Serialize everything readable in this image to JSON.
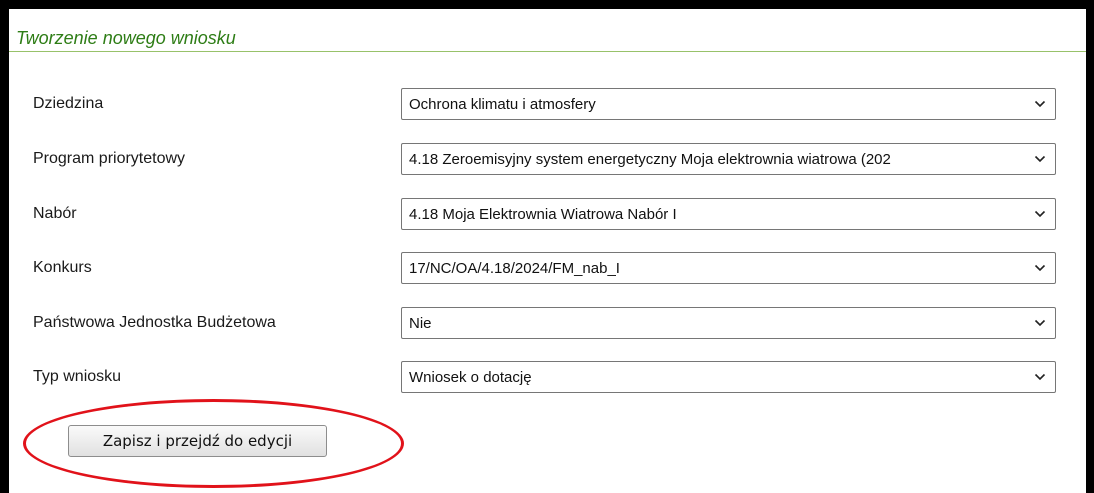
{
  "form": {
    "title": "Tworzenie nowego wniosku",
    "fields": [
      {
        "label": "Dziedzina",
        "value": "Ochrona klimatu i atmosfery"
      },
      {
        "label": "Program priorytetowy",
        "value": "4.18 Zeroemisyjny system energetyczny Moja elektrownia wiatrowa (202"
      },
      {
        "label": "Nabór",
        "value": "4.18 Moja Elektrownia Wiatrowa Nabór I"
      },
      {
        "label": "Konkurs",
        "value": "17/NC/OA/4.18/2024/FM_nab_I"
      },
      {
        "label": "Państwowa Jednostka Budżetowa",
        "value": "Nie"
      },
      {
        "label": "Typ wniosku",
        "value": "Wniosek o dotację"
      }
    ],
    "submit_label": "Zapisz i przejdź do edycji"
  },
  "colors": {
    "title": "#2e7d16",
    "title_rule": "#98c26a",
    "frame": "#000000",
    "highlight_ellipse": "#e1121a"
  },
  "icons": {
    "dropdown": "chevron-down-icon"
  }
}
